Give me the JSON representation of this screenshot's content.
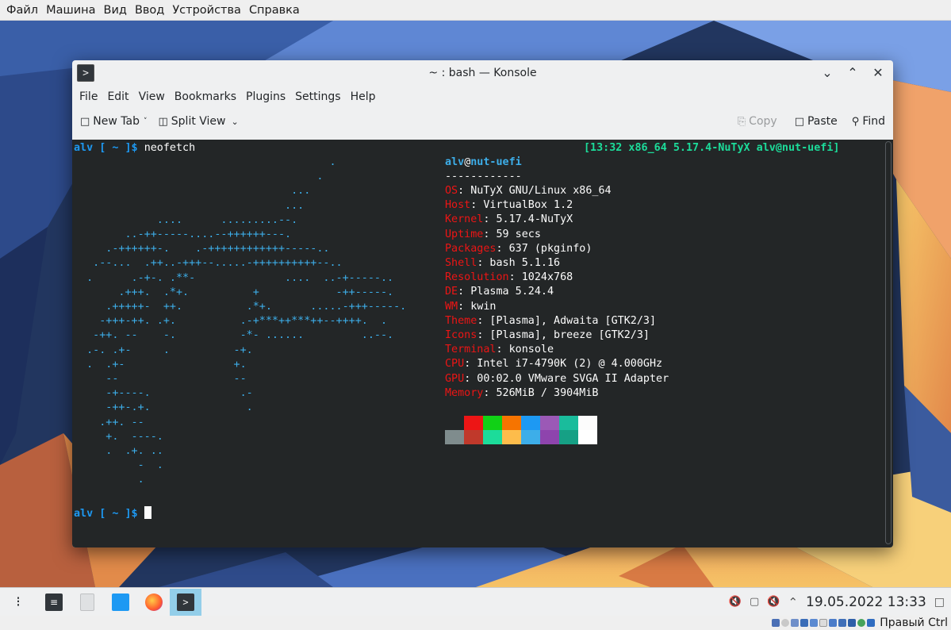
{
  "vbox_menu": [
    "Файл",
    "Машина",
    "Вид",
    "Ввод",
    "Устройства",
    "Справка"
  ],
  "window": {
    "title": "~ : bash — Konsole",
    "controls": [
      "minimize-icon",
      "maximize-icon",
      "close-icon"
    ]
  },
  "menu": [
    "File",
    "Edit",
    "View",
    "Bookmarks",
    "Plugins",
    "Settings",
    "Help"
  ],
  "toolbar": {
    "new_tab": "New Tab",
    "split_view": "Split View",
    "copy": "Copy",
    "paste": "Paste",
    "find": "Find"
  },
  "terminal": {
    "prompt": "alv [ ~ ]$",
    "command": "neofetch",
    "title_right": "[13:32 x86_64 5.17.4-NuTyX alv@nut-uefi]",
    "user": "alv",
    "at": "@",
    "host": "nut-uefi",
    "separator": "------------",
    "info": [
      {
        "key": "OS",
        "value": ": NuTyX GNU/Linux x86_64"
      },
      {
        "key": "Host",
        "value": ": VirtualBox 1.2"
      },
      {
        "key": "Kernel",
        "value": ": 5.17.4-NuTyX"
      },
      {
        "key": "Uptime",
        "value": ": 59 secs"
      },
      {
        "key": "Packages",
        "value": ": 637 (pkginfo)"
      },
      {
        "key": "Shell",
        "value": ": bash 5.1.16"
      },
      {
        "key": "Resolution",
        "value": ": 1024x768"
      },
      {
        "key": "DE",
        "value": ": Plasma 5.24.4"
      },
      {
        "key": "WM",
        "value": ": kwin"
      },
      {
        "key": "Theme",
        "value": ": [Plasma], Adwaita [GTK2/3]"
      },
      {
        "key": "Icons",
        "value": ": [Plasma], breeze [GTK2/3]"
      },
      {
        "key": "Terminal",
        "value": ": konsole"
      },
      {
        "key": "CPU",
        "value": ": Intel i7-4790K (2) @ 4.000GHz"
      },
      {
        "key": "GPU",
        "value": ": 00:02.0 VMware SVGA II Adapter"
      },
      {
        "key": "Memory",
        "value": ": 526MiB / 3904MiB"
      }
    ],
    "ascii_logo": [
      "                                        .",
      "                                      .",
      "                                  ...",
      "                                 ...",
      "             ....      .........--.",
      "        ..-++-----....--++++++---.",
      "     .-++++++-.    .-++++++++++++-----..",
      "   .--...  .++..-+++--.....-++++++++++--..",
      "  .      .-+-. .**-              ....  ..-+-----..",
      "       .+++.  .*+.          +            -++-----.",
      "     .+++++-  ++.          .*+.      .....-+++-----.",
      "    -+++-++. .+.          .-+***++***++--++++.  .",
      "   -++. --    -.          -*- ......         ..--.",
      "  .-. .+-     .          -+.",
      "  .  .+-                 +.",
      "     --                  --",
      "     -+----.              .-",
      "     -++-.+.               .",
      "    .++. --",
      "     +.  ----.",
      "     .  .+. ..",
      "          -  .",
      "          ."
    ],
    "palette_top": [
      "#232627",
      "#ed1515",
      "#11d116",
      "#f67400",
      "#1d99f3",
      "#9b59b6",
      "#1abc9c",
      "#fcfcfc"
    ],
    "palette_bottom": [
      "#7f8c8d",
      "#c0392b",
      "#1cdc9a",
      "#fdbc4b",
      "#3daee9",
      "#8e44ad",
      "#16a085",
      "#ffffff"
    ],
    "prompt2": "alv [ ~ ]$"
  },
  "taskbar": {
    "apps": [
      "application-launcher-icon",
      "pager-icon",
      "files-icon",
      "file-manager-icon",
      "firefox-icon",
      "konsole-icon"
    ],
    "clock": "19.05.2022 13:33"
  },
  "vbox_status": {
    "host_key": "Правый Ctrl"
  }
}
